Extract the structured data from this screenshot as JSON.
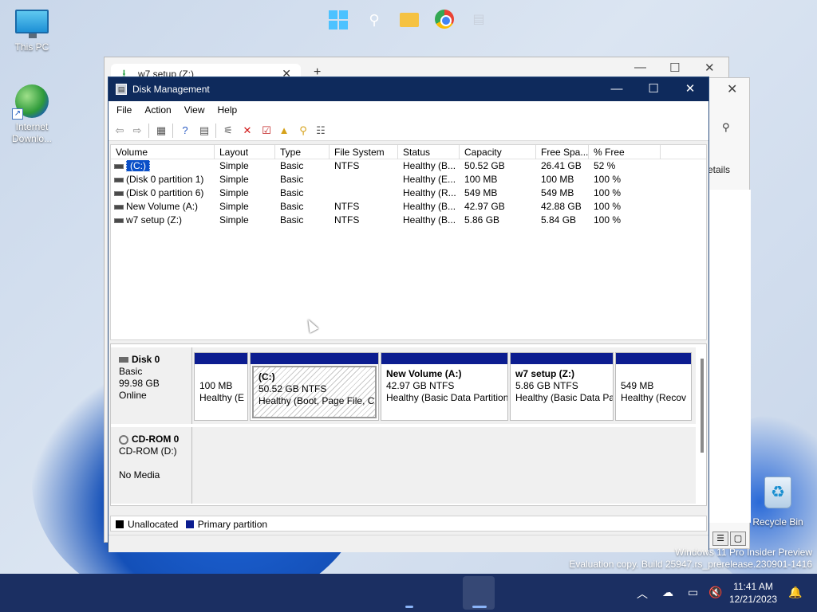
{
  "desktop": {
    "icons": [
      {
        "name": "this-pc",
        "label": "This PC"
      },
      {
        "name": "internet-download-manager",
        "label": "Internet Downlo..."
      },
      {
        "name": "recycle-bin",
        "label": "Recycle Bin"
      }
    ]
  },
  "bg_window": {
    "tab_title": "w7 setup (Z:)",
    "details_label": "etails"
  },
  "window": {
    "title": "Disk Management",
    "menu": [
      "File",
      "Action",
      "View",
      "Help"
    ],
    "columns": [
      "Volume",
      "Layout",
      "Type",
      "File System",
      "Status",
      "Capacity",
      "Free Spa...",
      "% Free"
    ],
    "volumes": [
      {
        "volume": "(C:)",
        "layout": "Simple",
        "type": "Basic",
        "fs": "NTFS",
        "status": "Healthy (B...",
        "capacity": "50.52 GB",
        "free": "26.41 GB",
        "pct": "52 %"
      },
      {
        "volume": "(Disk 0 partition 1)",
        "layout": "Simple",
        "type": "Basic",
        "fs": "",
        "status": "Healthy (E...",
        "capacity": "100 MB",
        "free": "100 MB",
        "pct": "100 %"
      },
      {
        "volume": "(Disk 0 partition 6)",
        "layout": "Simple",
        "type": "Basic",
        "fs": "",
        "status": "Healthy (R...",
        "capacity": "549 MB",
        "free": "549 MB",
        "pct": "100 %"
      },
      {
        "volume": "New Volume (A:)",
        "layout": "Simple",
        "type": "Basic",
        "fs": "NTFS",
        "status": "Healthy (B...",
        "capacity": "42.97 GB",
        "free": "42.88 GB",
        "pct": "100 %"
      },
      {
        "volume": "w7 setup (Z:)",
        "layout": "Simple",
        "type": "Basic",
        "fs": "NTFS",
        "status": "Healthy (B...",
        "capacity": "5.86 GB",
        "free": "5.84 GB",
        "pct": "100 %"
      }
    ],
    "disk0": {
      "name": "Disk 0",
      "type": "Basic",
      "size": "99.98 GB",
      "state": "Online",
      "partitions": [
        {
          "title": "",
          "line1": "100 MB",
          "line2": "Healthy (E"
        },
        {
          "title": "(C:)",
          "line1": "50.52 GB NTFS",
          "line2": "Healthy (Boot, Page File, Cra"
        },
        {
          "title": "New Volume  (A:)",
          "line1": "42.97 GB NTFS",
          "line2": "Healthy (Basic Data Partition"
        },
        {
          "title": "w7 setup  (Z:)",
          "line1": "5.86 GB NTFS",
          "line2": "Healthy (Basic Data Pa"
        },
        {
          "title": "",
          "line1": "549 MB",
          "line2": "Healthy (Recov"
        }
      ]
    },
    "cdrom": {
      "name": "CD-ROM 0",
      "type": "CD-ROM (D:)",
      "state": "No Media"
    },
    "legend": {
      "unallocated": "Unallocated",
      "primary": "Primary partition"
    }
  },
  "watermark": {
    "line1": "Windows 11 Pro Insider Preview",
    "line2": "Evaluation copy. Build 25947.rs_prerelease.230901-1416"
  },
  "taskbar": {
    "time": "11:41 AM",
    "date": "12/21/2023"
  },
  "colors": {
    "title_bar": "#0e2a5c",
    "primary_partition": "#0c1d90",
    "taskbar": "#1b2f62"
  }
}
